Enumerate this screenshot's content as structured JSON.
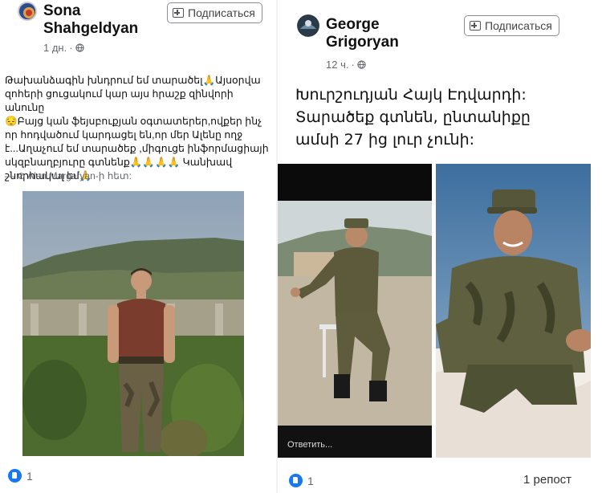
{
  "left_post": {
    "author": "Sona Shahgeldyan",
    "author_line1": "Sona",
    "author_line2": "Shahgeldyan",
    "time": "1 дн.",
    "separator": "·",
    "subscribe_label": "Подписаться",
    "text_lines": [
      "Թախանձագին խնդրում եմ տարածել🙏Այսօրվա",
      "զոհերի ցուցակում կար այս հրաշք զինվորի անունը",
      "😔Բայց կան ֆեյսբուքյան օգտատերեր,ովքեր ինչ",
      "որ հոդվածում կարդացել են,որ մեր Ալենը ողջ",
      "է...Աղաչում եմ տարածեք ,միգուցե ինֆորմացիայի",
      "սկզբնաղբյուրը գտնենք🙏🙏🙏🙏 Կանխավ",
      "շնորհակալ եմ🙏"
    ],
    "tagline": "— ⊘ Alen Margaryan-ի հետ:",
    "reactions_count": "1"
  },
  "right_post": {
    "author": "George Grigoryan",
    "author_line1": "George",
    "author_line2": "Grigoryan",
    "time": "12 ч.",
    "separator": "·",
    "subscribe_label": "Подписаться",
    "text_lines": [
      "Խուրշուդյան Հայկ Էդվարդի:",
      "Տարածեք գտնեն, ընտանիքը",
      "ամսի 27 ից լուր չունի:"
    ],
    "reply_hint": "Ответить...",
    "reactions_count": "1",
    "repost_label": "1 репост"
  },
  "colors": {
    "like_blue": "#1877f2",
    "meta_gray": "#65676b"
  },
  "icons": [
    "globe-icon",
    "like-icon",
    "plus-icon",
    "avatar-image",
    "tag-icon"
  ]
}
